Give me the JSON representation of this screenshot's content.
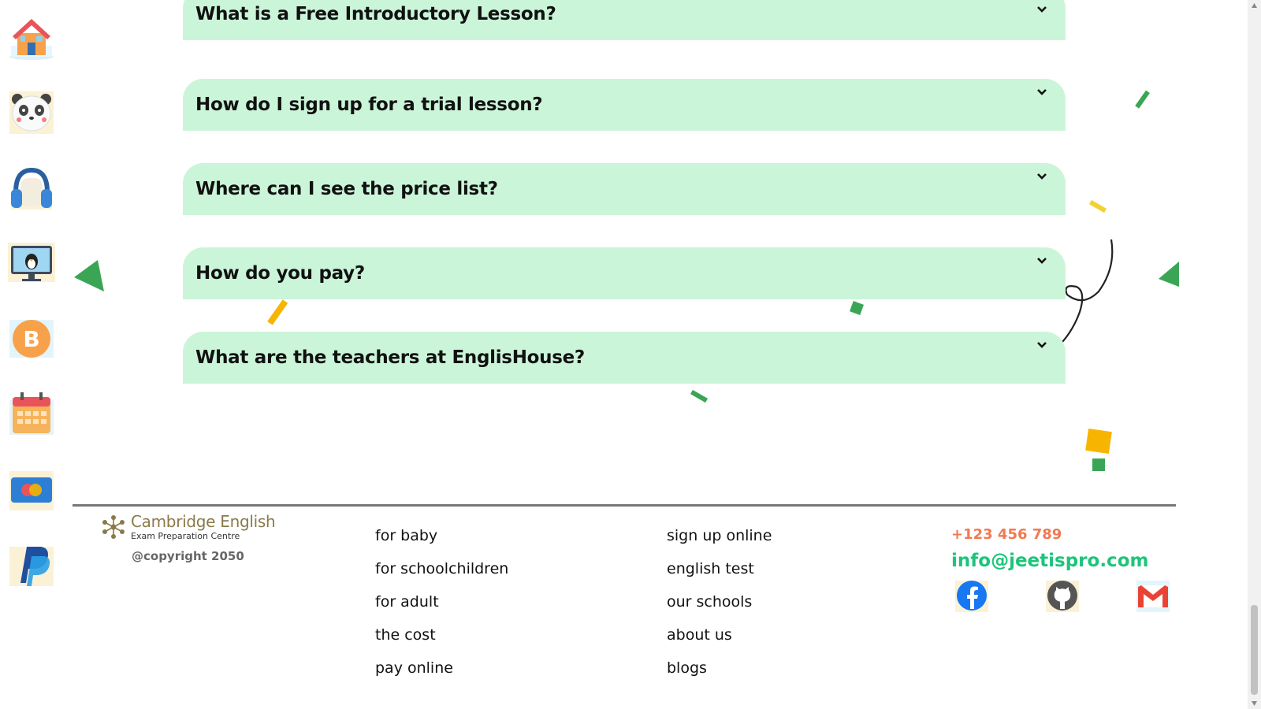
{
  "sidebar": {
    "icons": [
      {
        "name": "home-icon"
      },
      {
        "name": "panda-icon"
      },
      {
        "name": "headphones-icon"
      },
      {
        "name": "linux-monitor-icon"
      },
      {
        "name": "bitcoin-icon"
      },
      {
        "name": "calendar-icon"
      },
      {
        "name": "card-icon"
      },
      {
        "name": "paypal-icon"
      }
    ]
  },
  "faq": {
    "items": [
      {
        "question": "What is a Free Introductory Lesson?"
      },
      {
        "question": "How do I sign up for a trial lesson?"
      },
      {
        "question": "Where can I see the price list?"
      },
      {
        "question": "How do you pay?"
      },
      {
        "question": "What are the teachers at EnglisHouse?"
      }
    ],
    "chevron_icon": "chevron-down-icon"
  },
  "footer": {
    "brand_name": "Cambridge English",
    "brand_sub": "Exam Preparation Centre",
    "copyright": "@copyright 2050",
    "col1": [
      "for baby",
      "for schoolchildren",
      "for adult",
      "the cost",
      "pay online"
    ],
    "col2": [
      "sign up online",
      "english test",
      "our schools",
      "about us",
      "blogs"
    ],
    "phone": "+123 456 789",
    "email": "info@jeetispro.com",
    "social": [
      "facebook-icon",
      "github-icon",
      "gmail-icon"
    ]
  },
  "colors": {
    "faq_bg": "#cbf5d9",
    "accent_green": "#1dc47a",
    "accent_orange": "#f07a52",
    "brand_olive": "#8a7a4a"
  }
}
